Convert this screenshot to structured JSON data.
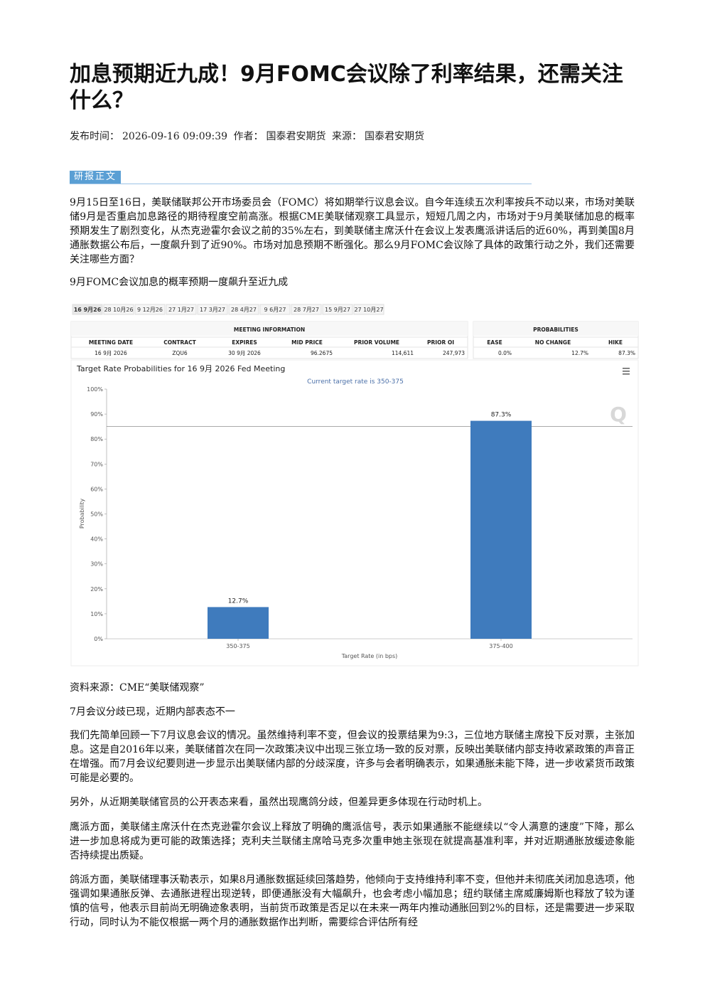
{
  "article": {
    "title": "加息预期近九成！9月FOMC会议除了利率结果，还需关注什么？",
    "meta": {
      "published_label": "发布时间：",
      "published_time": "2026-09-16 09:09:39",
      "author_label": "作者：",
      "author": "国泰君安期货",
      "source_label": "来源：",
      "source": "国泰君安期货"
    },
    "section_tag": "研报正文",
    "paragraphs": [
      "9月15日至16日，美联储联邦公开市场委员会（FOMC）将如期举行议息会议。自今年连续五次利率按兵不动以来，市场对美联储9月是否重启加息路径的期待程度空前高涨。根据CME美联储观察工具显示，短短几周之内，市场对于9月美联储加息的概率预期发生了剧烈变化，从杰克逊霍尔会议之前的35%左右，到美联储主席沃什在会议上发表鹰派讲话后的近60%，再到美国8月通胀数据公布后，一度飙升到了近90%。市场对加息预期不断强化。那么9月FOMC会议除了具体的政策行动之外，我们还需要关注哪些方面？",
      "9月FOMC会议加息的概率预期一度飙升至近九成"
    ],
    "figure_caption": "资料来源：CME“美联储观察”",
    "paragraphs_after": [
      "7月会议分歧已现，近期内部表态不一",
      "我们先简单回顾一下7月议息会议的情况。虽然维持利率不变，但会议的投票结果为9:3，三位地方联储主席投下反对票，主张加息。这是自2016年以来，美联储首次在同一次政策决议中出现三张立场一致的反对票，反映出美联储内部支持收紧政策的声音正在增强。而7月会议纪要则进一步显示出美联储内部的分歧深度，许多与会者明确表示，如果通胀未能下降，进一步收紧货币政策可能是必要的。",
      "另外，从近期美联储官员的公开表态来看，虽然出现鹰鸽分歧，但差异更多体现在行动时机上。",
      "鹰派方面，美联储主席沃什在杰克逊霍尔会议上释放了明确的鹰派信号，表示如果通胀不能继续以“令人满意的速度”下降，那么进一步加息将成为更可能的政策选择；克利夫兰联储主席哈马克多次重申她主张现在就提高基准利率，并对近期通胀放缓迹象能否持续提出质疑。",
      "鸽派方面，美联储理事沃勒表示，如果8月通胀数据延续回落趋势，他倾向于支持维持利率不变，但他并未彻底关闭加息选项，他强调如果通胀反弹、去通胀进程出现逆转，即便通胀没有大幅飙升，也会考虑小幅加息；纽约联储主席威廉姆斯也释放了较为谨慎的信号，他表示目前尚无明确迹象表明，当前货币政策是否足以在未来一两年内推动通胀回到2%的目标，还是需要进一步采取行动，同时认为不能仅根据一两个月的通胀数据作出判断，需要综合评估所有经"
    ]
  },
  "tool": {
    "date_tabs": [
      "16 9月26",
      "28 10月26",
      "9 12月26",
      "27 1月27",
      "17 3月27",
      "28 4月27",
      "9 6月27",
      "28 7月27",
      "15 9月27",
      "27 10月27"
    ],
    "meeting_info_title": "MEETING INFORMATION",
    "probabilities_title": "PROBABILITIES",
    "meeting_headers": [
      "MEETING DATE",
      "CONTRACT",
      "EXPIRES",
      "MID PRICE",
      "PRIOR VOLUME",
      "PRIOR OI"
    ],
    "meeting_values": [
      "16 9月 2026",
      "ZQU6",
      "30 9月 2026",
      "96.2675",
      "114,611",
      "247,973"
    ],
    "prob_headers": [
      "EASE",
      "NO CHANGE",
      "HIKE"
    ],
    "prob_values": [
      "0.0%",
      "12.7%",
      "87.3%"
    ]
  },
  "chart_data": {
    "type": "bar",
    "title": "Target Rate Probabilities for 16 9月 2026 Fed Meeting",
    "subtitle": "Current target rate is 350-375",
    "categories": [
      "350-375",
      "375-400"
    ],
    "values": [
      12.7,
      87.3
    ],
    "data_labels": [
      "12.7%",
      "87.3%"
    ],
    "xlabel": "Target Rate (in bps)",
    "ylabel": "Probability",
    "ylim": [
      0,
      100
    ],
    "yticks": [
      "0%",
      "10%",
      "20%",
      "30%",
      "40%",
      "50%",
      "60%",
      "70%",
      "80%",
      "90%",
      "100%"
    ],
    "bar_color": "#3f7bbd",
    "grid": false,
    "reference_line_value": 85,
    "watermark": "Q"
  }
}
